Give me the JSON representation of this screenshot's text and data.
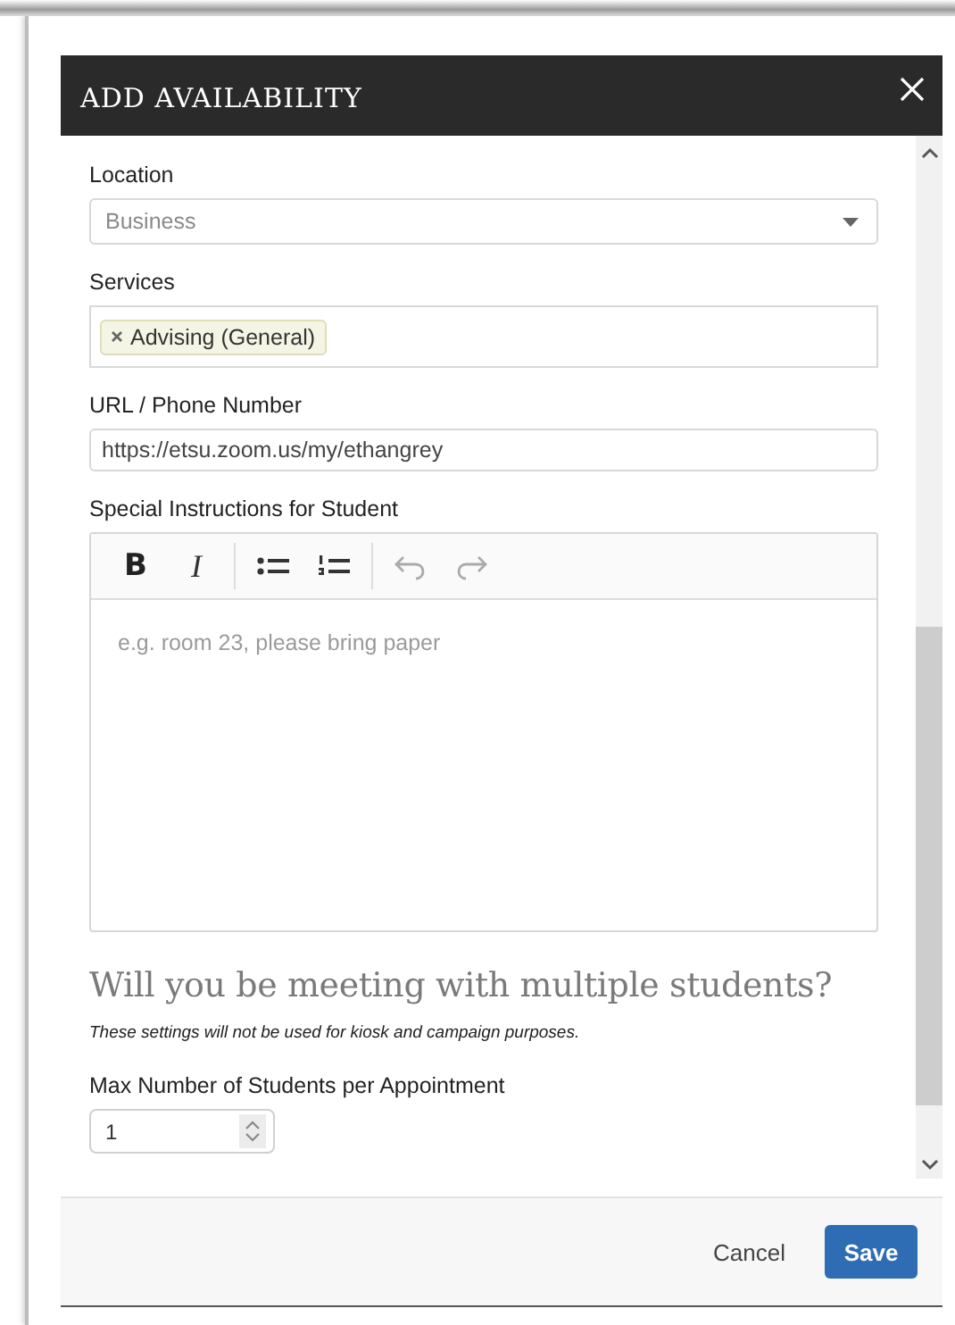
{
  "dialog_title": "ADD AVAILABILITY",
  "fields": [
    {
      "kind": "select",
      "label": "Location",
      "value": "Business"
    },
    {
      "kind": "tags",
      "label": "Services",
      "tags": [
        "Advising (General)"
      ]
    },
    {
      "kind": "text",
      "label": "URL / Phone Number",
      "value": "https://etsu.zoom.us/my/ethangrey"
    },
    {
      "kind": "editor",
      "label": "Special Instructions for Student",
      "placeholder": "e.g. room 23, please bring paper",
      "toolbar": [
        {
          "kind": "bold",
          "glyph": "B"
        },
        {
          "kind": "italic",
          "glyph": "I"
        },
        {
          "kind": "separator"
        },
        {
          "kind": "bullets"
        },
        {
          "kind": "numbers"
        },
        {
          "kind": "separator"
        },
        {
          "kind": "undo"
        },
        {
          "kind": "redo"
        }
      ]
    }
  ],
  "section": {
    "heading": "Will you be meeting with multiple students?",
    "note": "These settings will not be used for kiosk and campaign purposes."
  },
  "number_field": {
    "label": "Max Number of Students per Appointment",
    "value": "1"
  },
  "buttons": [
    {
      "kind": "secondary",
      "label": "Cancel"
    },
    {
      "kind": "primary",
      "label": "Save"
    }
  ]
}
